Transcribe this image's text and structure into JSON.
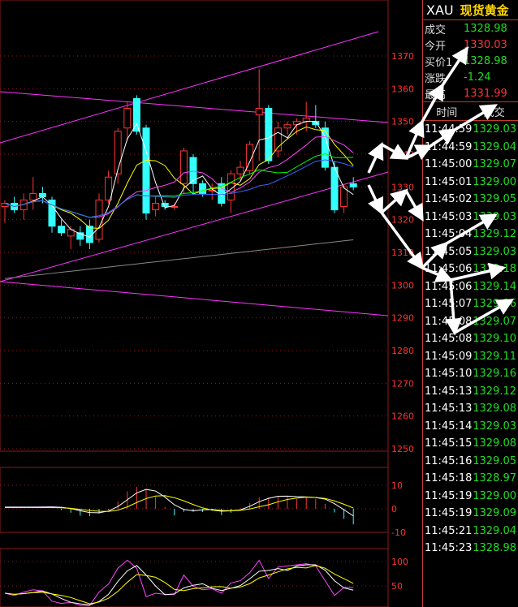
{
  "colors": {
    "up": "#ff3333",
    "down": "#33ffff",
    "grid": "#8b1a1a",
    "channel": "#ff33ff",
    "ma_white": "#ffffff",
    "ma_yellow": "#ffff00",
    "ma_magenta": "#ff44ff",
    "ma_green": "#00ff00",
    "ma_blue": "#3366ff",
    "ma_gray": "#888888",
    "green_text": "#22dd22",
    "red_text": "#ff3333"
  },
  "quote": {
    "symbol": "XAU",
    "name": "现货黄金",
    "rows": [
      {
        "label": "成交",
        "value": "1328.98",
        "color": "#22dd22"
      },
      {
        "label": "今开",
        "value": "1330.03",
        "color": "#ff3333"
      },
      {
        "label": "买价1",
        "value": "1328.98",
        "color": "#22dd22"
      },
      {
        "label": "涨跌",
        "value": "-1.24",
        "color": "#22dd22"
      },
      {
        "label": "最高",
        "value": "1331.99",
        "color": "#ff3333"
      }
    ],
    "ticks_header": {
      "time": "时间",
      "price": "成交"
    },
    "ticks": [
      {
        "time": "11:44:59",
        "price": "1329.03"
      },
      {
        "time": "11:44:59",
        "price": "1329.04"
      },
      {
        "time": "11:45:00",
        "price": "1329.07"
      },
      {
        "time": "11:45:01",
        "price": "1329.00"
      },
      {
        "time": "11:45:02",
        "price": "1329.05"
      },
      {
        "time": "11:45:03",
        "price": "1329.03"
      },
      {
        "time": "11:45:04",
        "price": "1329.12"
      },
      {
        "time": "11:45:05",
        "price": "1329.03"
      },
      {
        "time": "11:45:06",
        "price": "1329.18"
      },
      {
        "time": "11:45:06",
        "price": "1329.14"
      },
      {
        "time": "11:45:07",
        "price": "1329.16"
      },
      {
        "time": "11:45:08",
        "price": "1329.07"
      },
      {
        "time": "11:45:08",
        "price": "1329.10"
      },
      {
        "time": "11:45:09",
        "price": "1329.11"
      },
      {
        "time": "11:45:10",
        "price": "1329.16"
      },
      {
        "time": "11:45:13",
        "price": "1329.12"
      },
      {
        "time": "11:45:13",
        "price": "1329.08"
      },
      {
        "time": "11:45:14",
        "price": "1329.03"
      },
      {
        "time": "11:45:15",
        "price": "1329.08"
      },
      {
        "time": "11:45:16",
        "price": "1329.05"
      },
      {
        "time": "11:45:18",
        "price": "1328.97"
      },
      {
        "time": "11:45:19",
        "price": "1329.00"
      },
      {
        "time": "11:45:19",
        "price": "1329.09"
      },
      {
        "time": "11:45:21",
        "price": "1329.04"
      },
      {
        "time": "11:45:23",
        "price": "1328.98"
      }
    ]
  },
  "chart_data": {
    "type": "candlestick",
    "price_axis": {
      "ticks": [
        1370,
        1360,
        1350,
        1340,
        1330,
        1320,
        1310,
        1300,
        1290,
        1280,
        1270,
        1260,
        1250
      ],
      "range": [
        1250,
        1376
      ]
    },
    "macd_axis": {
      "ticks": [
        10,
        0,
        -10
      ]
    },
    "kdj_axis": {
      "ticks": [
        100,
        50
      ]
    },
    "candles": [
      {
        "o": 1324,
        "h": 1326,
        "l": 1319,
        "c": 1325
      },
      {
        "o": 1325,
        "h": 1327,
        "l": 1322,
        "c": 1323
      },
      {
        "o": 1323,
        "h": 1328,
        "l": 1320,
        "c": 1326
      },
      {
        "o": 1326,
        "h": 1333,
        "l": 1323,
        "c": 1328
      },
      {
        "o": 1328,
        "h": 1330,
        "l": 1325,
        "c": 1327
      },
      {
        "o": 1326,
        "h": 1327,
        "l": 1316,
        "c": 1318
      },
      {
        "o": 1318,
        "h": 1320,
        "l": 1315,
        "c": 1316
      },
      {
        "o": 1315,
        "h": 1318,
        "l": 1311,
        "c": 1317
      },
      {
        "o": 1316,
        "h": 1318,
        "l": 1312,
        "c": 1314
      },
      {
        "o": 1318,
        "h": 1320,
        "l": 1311,
        "c": 1313
      },
      {
        "o": 1314,
        "h": 1328,
        "l": 1313,
        "c": 1326
      },
      {
        "o": 1326,
        "h": 1335,
        "l": 1325,
        "c": 1333
      },
      {
        "o": 1334,
        "h": 1348,
        "l": 1331,
        "c": 1347
      },
      {
        "o": 1348,
        "h": 1356,
        "l": 1344,
        "c": 1354
      },
      {
        "o": 1357,
        "h": 1358,
        "l": 1346,
        "c": 1347
      },
      {
        "o": 1348,
        "h": 1349,
        "l": 1320,
        "c": 1322
      },
      {
        "o": 1323,
        "h": 1327,
        "l": 1321,
        "c": 1325
      },
      {
        "o": 1325,
        "h": 1326,
        "l": 1323,
        "c": 1324
      },
      {
        "o": 1324,
        "h": 1325,
        "l": 1323,
        "c": 1324
      },
      {
        "o": 1331,
        "h": 1342,
        "l": 1328,
        "c": 1341
      },
      {
        "o": 1339,
        "h": 1340,
        "l": 1328,
        "c": 1331
      },
      {
        "o": 1331,
        "h": 1332,
        "l": 1327,
        "c": 1328
      },
      {
        "o": 1329,
        "h": 1331,
        "l": 1326,
        "c": 1329
      },
      {
        "o": 1331,
        "h": 1333,
        "l": 1324,
        "c": 1325
      },
      {
        "o": 1326,
        "h": 1335,
        "l": 1322,
        "c": 1334
      },
      {
        "o": 1334,
        "h": 1338,
        "l": 1332,
        "c": 1336
      },
      {
        "o": 1335,
        "h": 1344,
        "l": 1334,
        "c": 1343
      },
      {
        "o": 1352,
        "h": 1366,
        "l": 1338,
        "c": 1354
      },
      {
        "o": 1354,
        "h": 1355,
        "l": 1337,
        "c": 1338
      },
      {
        "o": 1341,
        "h": 1350,
        "l": 1339,
        "c": 1348
      },
      {
        "o": 1348,
        "h": 1350,
        "l": 1346,
        "c": 1349
      },
      {
        "o": 1349,
        "h": 1351,
        "l": 1346,
        "c": 1350
      },
      {
        "o": 1350,
        "h": 1356,
        "l": 1347,
        "c": 1351
      },
      {
        "o": 1350,
        "h": 1355,
        "l": 1348,
        "c": 1349
      },
      {
        "o": 1348,
        "h": 1350,
        "l": 1335,
        "c": 1336
      },
      {
        "o": 1336,
        "h": 1338,
        "l": 1322,
        "c": 1323
      },
      {
        "o": 1324,
        "h": 1331,
        "l": 1322,
        "c": 1330
      },
      {
        "o": 1331,
        "h": 1333,
        "l": 1329,
        "c": 1330
      }
    ]
  }
}
